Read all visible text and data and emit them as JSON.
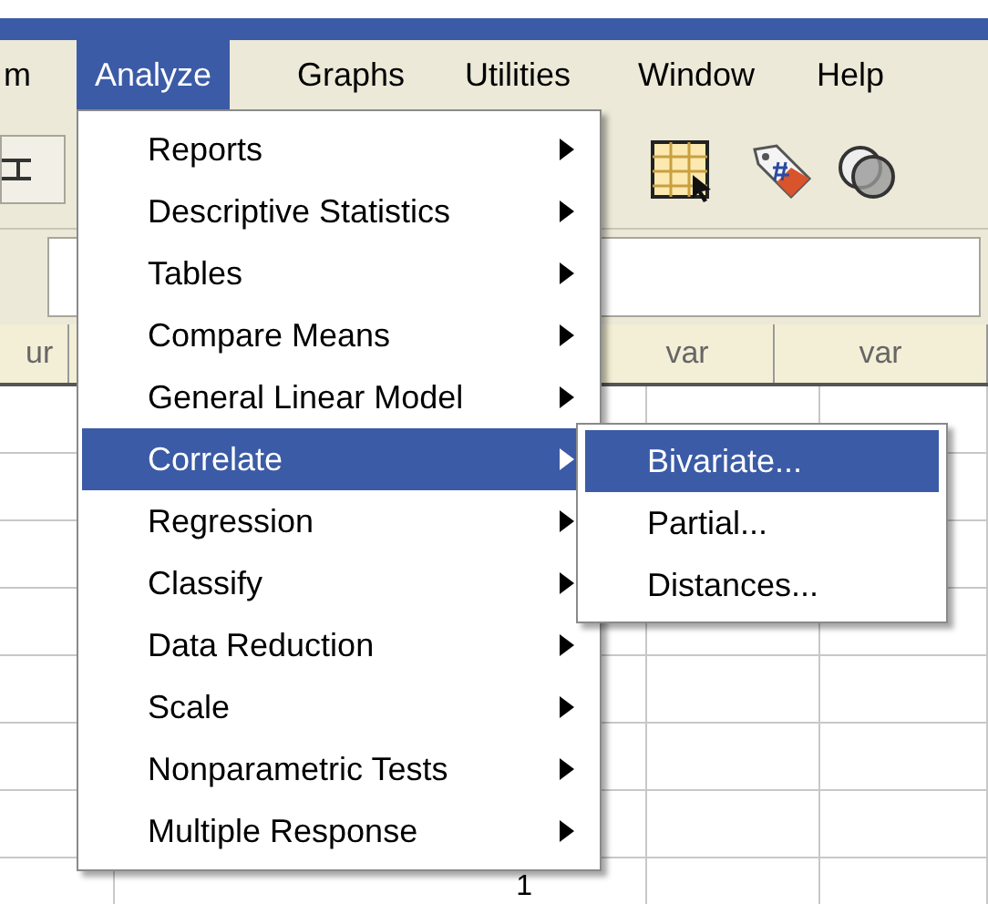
{
  "menubar": [
    {
      "label": "m",
      "selected": false
    },
    {
      "label": "Analyze",
      "selected": true
    },
    {
      "label": "Graphs",
      "selected": false
    },
    {
      "label": "Utilities",
      "selected": false
    },
    {
      "label": "Window",
      "selected": false
    },
    {
      "label": "Help",
      "selected": false
    }
  ],
  "analyze_menu": [
    {
      "label": "Reports",
      "selected": false,
      "submenu": true
    },
    {
      "label": "Descriptive Statistics",
      "selected": false,
      "submenu": true
    },
    {
      "label": "Tables",
      "selected": false,
      "submenu": true
    },
    {
      "label": "Compare Means",
      "selected": false,
      "submenu": true
    },
    {
      "label": "General Linear Model",
      "selected": false,
      "submenu": true
    },
    {
      "label": "Correlate",
      "selected": true,
      "submenu": true
    },
    {
      "label": "Regression",
      "selected": false,
      "submenu": true
    },
    {
      "label": "Classify",
      "selected": false,
      "submenu": true
    },
    {
      "label": "Data Reduction",
      "selected": false,
      "submenu": true
    },
    {
      "label": "Scale",
      "selected": false,
      "submenu": true
    },
    {
      "label": "Nonparametric Tests",
      "selected": false,
      "submenu": true
    },
    {
      "label": "Multiple Response",
      "selected": false,
      "submenu": true
    }
  ],
  "correlate_submenu": [
    {
      "label": "Bivariate...",
      "selected": true
    },
    {
      "label": "Partial...",
      "selected": false
    },
    {
      "label": "Distances...",
      "selected": false
    }
  ],
  "grid": {
    "column_headers": [
      "ur",
      "var",
      "var"
    ],
    "bottom_cell": "1"
  }
}
